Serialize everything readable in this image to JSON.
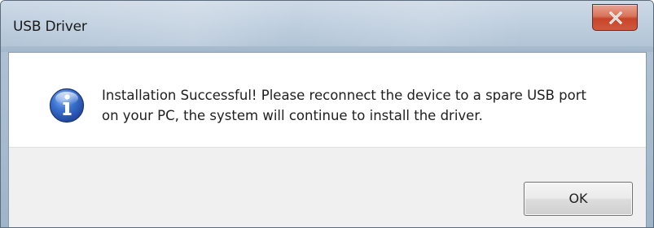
{
  "window": {
    "title": "USB Driver",
    "close_icon": "close-x-icon"
  },
  "dialog": {
    "icon": "info-icon",
    "message_line1": "Installation Successful! Please reconnect the device to a spare USB port",
    "message_line2": "on your PC, the system will continue to install the driver."
  },
  "buttons": {
    "ok_label": "OK"
  },
  "colors": {
    "close_button": "#d0583d",
    "info_icon_blue": "#2f5fb8",
    "footer_background": "#f0f0f0"
  }
}
